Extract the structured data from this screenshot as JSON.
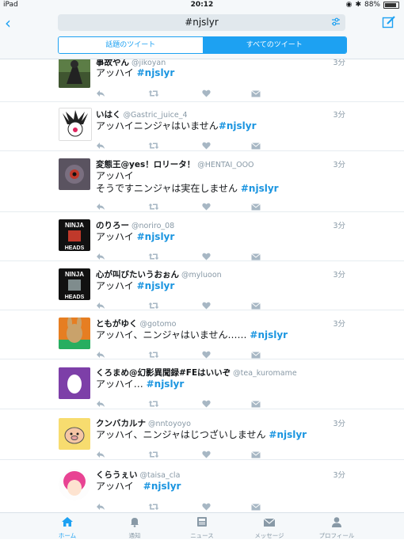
{
  "status": {
    "device": "iPad",
    "time": "20:12",
    "battery": "88%"
  },
  "search": {
    "query": "#njslyr"
  },
  "segments": {
    "left": "話題のツイート",
    "right": "すべてのツイート"
  },
  "tweets": [
    {
      "name": "事故やん",
      "handle": "@jikoyan",
      "time": "3分",
      "text": "アッハイ",
      "tag": "#njslyr"
    },
    {
      "name": "いはく",
      "handle": "@Gastric_juice_4",
      "time": "3分",
      "text": "アッハイニンジャはいません",
      "tag": "#njslyr"
    },
    {
      "name": "変態王@yes！ロリータ！",
      "handle": "@HENTAI_OOO",
      "time": "3分",
      "text": "アッハイ",
      "text2": "そうですニンジャは実在しません",
      "tag": "#njslyr"
    },
    {
      "name": "のりろー",
      "handle": "@noriro_08",
      "time": "3分",
      "text": "アッハイ",
      "tag": "#njslyr"
    },
    {
      "name": "心が叫びたいうおぉん",
      "handle": "@myluoon",
      "time": "3分",
      "text": "アッハイ",
      "tag": "#njslyr"
    },
    {
      "name": "ともがゆく",
      "handle": "@gotomo",
      "time": "3分",
      "text": "アッハイ、ニンジャはいません……",
      "tag": "#njslyr"
    },
    {
      "name": "くろまめ@幻影異聞録#FEはいいぞ",
      "handle": "@tea_kuromame",
      "time": "3分",
      "text": "アッハイ…",
      "tag": "#njslyr"
    },
    {
      "name": "クンバカルナ",
      "handle": "@nntoyoyo",
      "time": "3分",
      "text": "アッハイ、ニンジャはじつざいしません",
      "tag": "#njslyr"
    },
    {
      "name": "くらうぇい",
      "handle": "@taisa_cla",
      "time": "3分",
      "text": "アッハイ　",
      "tag": "#njslyr"
    }
  ],
  "avatars": {
    "ninja_label_top": "NINJA",
    "ninja_label_bottom": "HEADS"
  },
  "tabs": [
    {
      "label": "ホーム"
    },
    {
      "label": "通知"
    },
    {
      "label": "ニュース"
    },
    {
      "label": "メッセージ"
    },
    {
      "label": "プロフィール"
    }
  ],
  "colors": {
    "accent": "#1da1f2",
    "hashtag": "#1b95e0",
    "muted": "#8899a6"
  }
}
